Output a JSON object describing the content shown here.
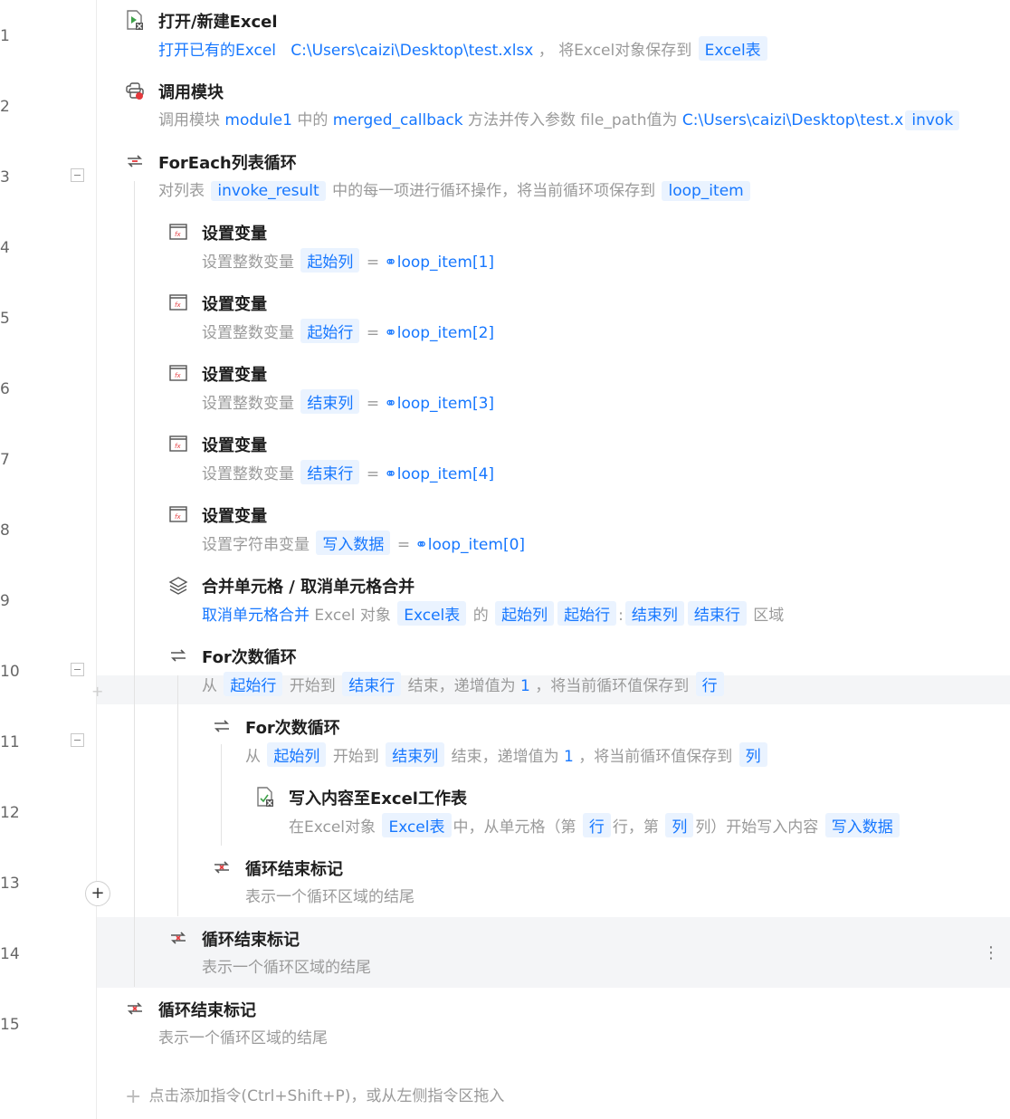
{
  "line_numbers": [
    "1",
    "2",
    "3",
    "4",
    "5",
    "6",
    "7",
    "8",
    "9",
    "10",
    "11",
    "12",
    "13",
    "14",
    "15"
  ],
  "steps": {
    "s1": {
      "title": "打开/新建Excel",
      "action": "打开已有的Excel",
      "path": "C:\\Users\\caizi\\Desktop\\test.xlsx",
      "sep": "，",
      "mid": "将Excel对象保存到",
      "var": "Excel表"
    },
    "s2": {
      "title": "调用模块",
      "pre": "调用模块",
      "module": "module1",
      "mid1": "中的",
      "method": "merged_callback",
      "mid2": "方法并传入参数 file_path值为",
      "path": "C:\\Users\\caizi\\Desktop\\test.x",
      "var": "invok"
    },
    "s3": {
      "title": "ForEach列表循环",
      "pre": "对列表",
      "list": "invoke_result",
      "mid": "中的每一项进行循环操作，将当前循环项保存到",
      "var": "loop_item"
    },
    "s4": {
      "title": "设置变量",
      "pre": "设置整数变量",
      "var": "起始列",
      "eq": "=",
      "val": "loop_item[1]"
    },
    "s5": {
      "title": "设置变量",
      "pre": "设置整数变量",
      "var": "起始行",
      "eq": "=",
      "val": "loop_item[2]"
    },
    "s6": {
      "title": "设置变量",
      "pre": "设置整数变量",
      "var": "结束列",
      "eq": "=",
      "val": "loop_item[3]"
    },
    "s7": {
      "title": "设置变量",
      "pre": "设置整数变量",
      "var": "结束行",
      "eq": "=",
      "val": "loop_item[4]"
    },
    "s8": {
      "title": "设置变量",
      "pre": "设置字符串变量",
      "var": "写入数据",
      "eq": "=",
      "val": "loop_item[0]"
    },
    "s9": {
      "title": "合并单元格 / 取消单元格合并",
      "action": "取消单元格合并",
      "mid": "Excel 对象",
      "obj": "Excel表",
      "de": "的",
      "v1": "起始列",
      "v2": "起始行",
      "colon": ":",
      "v3": "结束列",
      "v4": "结束行",
      "end": "区域"
    },
    "s10": {
      "title": "For次数循环",
      "from": "从",
      "start": "起始行",
      "mid1": "开始到",
      "end": "结束行",
      "mid2": "结束，递增值为",
      "step": "1",
      "mid3": "，将当前循环值保存到",
      "var": "行"
    },
    "s11": {
      "title": "For次数循环",
      "from": "从",
      "start": "起始列",
      "mid1": "开始到",
      "end": "结束列",
      "mid2": "结束，递增值为",
      "step": "1",
      "mid3": "，将当前循环值保存到",
      "var": "列"
    },
    "s12": {
      "title": "写入内容至Excel工作表",
      "pre": "在Excel对象",
      "obj": "Excel表",
      "mid1": "中，从单元格（第",
      "row": "行",
      "mid2": "行，第",
      "col": "列",
      "mid3": "列）开始写入内容",
      "val": "写入数据"
    },
    "s13": {
      "title": "循环结束标记",
      "desc": "表示一个循环区域的结尾"
    },
    "s14": {
      "title": "循环结束标记",
      "desc": "表示一个循环区域的结尾"
    },
    "s15": {
      "title": "循环结束标记",
      "desc": "表示一个循环区域的结尾"
    }
  },
  "add_hint": "点击添加指令(Ctrl+Shift+P)，或从左侧指令区拖入",
  "plus_symbol": "+",
  "kebab_symbol": "⋮",
  "colors": {
    "accent": "#1677ff",
    "token_bg": "#eaf3ff",
    "muted": "#9a9a9a",
    "hover_bg": "#f4f5f7"
  }
}
